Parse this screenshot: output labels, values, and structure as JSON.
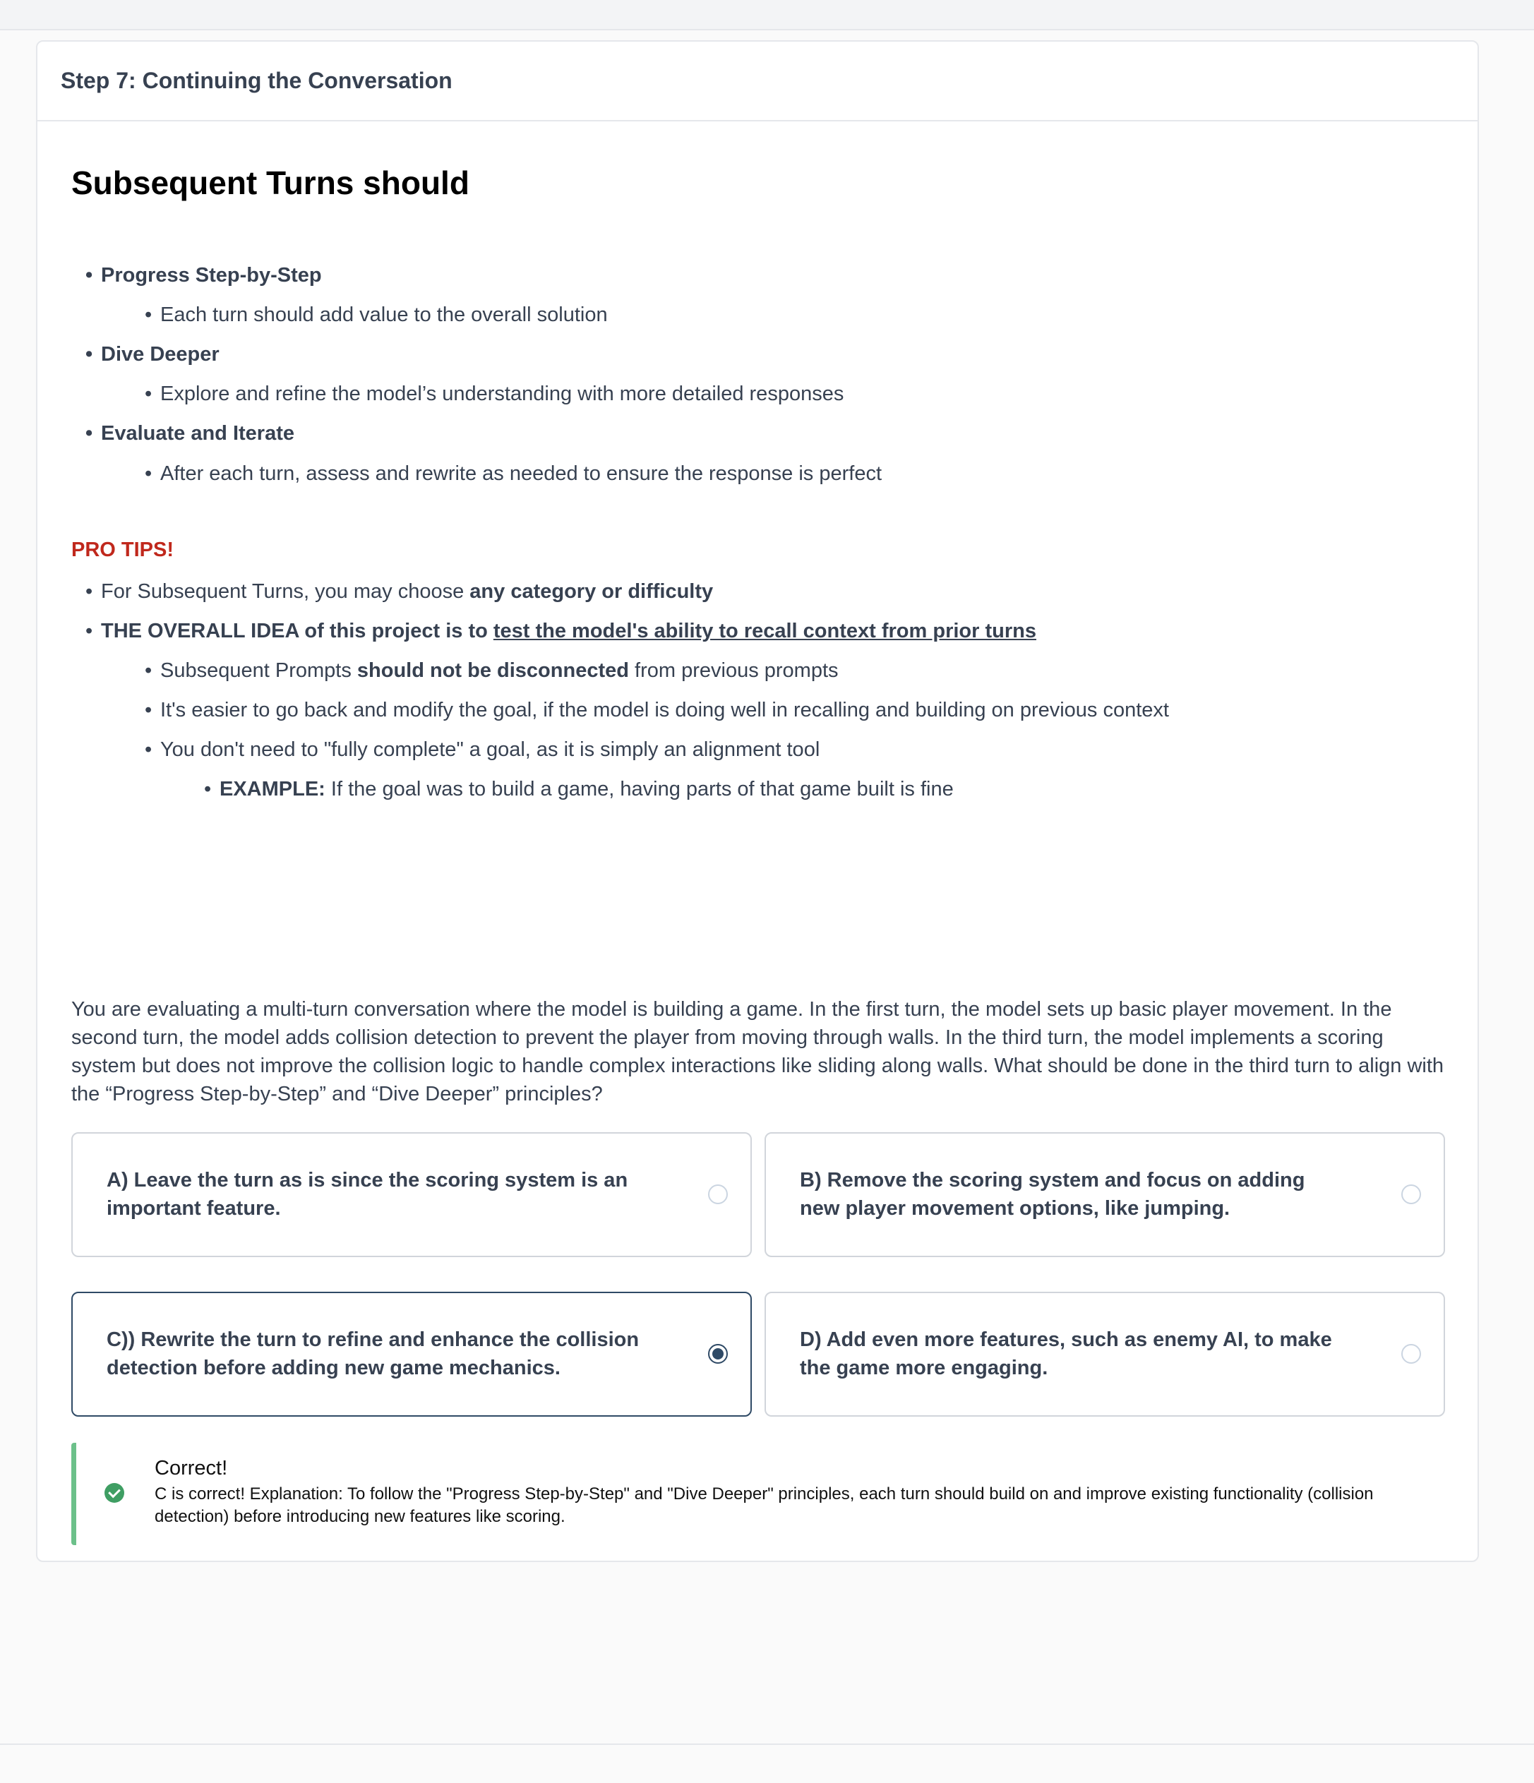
{
  "card": {
    "title": "Step 7: Continuing the Conversation"
  },
  "section": {
    "heading": "Subsequent Turns should",
    "items": [
      {
        "title": "Progress Step-by-Step",
        "detail": "Each turn should add value to the overall solution"
      },
      {
        "title": "Dive Deeper",
        "detail": "Explore and refine the model’s understanding with more detailed responses"
      },
      {
        "title": "Evaluate and Iterate",
        "detail": "After each turn, assess and rewrite as needed to ensure the response is perfect"
      }
    ]
  },
  "pro_tips": {
    "label": "PRO TIPS!",
    "tip1_prefix": "For Subsequent Turns, you may choose ",
    "tip1_bold": "any category or difficulty",
    "tip2_bold": "THE OVERALL IDEA of this project is to ",
    "tip2_underline": "test the model's ability to recall context from prior turns",
    "sub1_prefix": "Subsequent Prompts ",
    "sub1_bold": "should not be disconnected",
    "sub1_suffix": " from previous prompts",
    "sub2": "It's easier to go back and modify the goal, if the model is doing well in recalling and building on previous context",
    "sub3": "You don't need to \"fully complete\" a goal, as it is simply an alignment tool",
    "example_bold": "EXAMPLE:",
    "example_text": " If the goal was to build a game, having parts of that game built is fine"
  },
  "question": {
    "text": "You are evaluating a multi-turn conversation where the model is building a game. In the first turn, the model sets up basic player movement. In the second turn, the model adds collision detection to prevent the player from moving through walls. In the third turn, the model implements a scoring system but does not improve the collision logic to handle complex interactions like sliding along walls. What should be done in the third turn to align with the “Progress Step-by-Step” and “Dive Deeper” principles?",
    "options": [
      {
        "label": "A) Leave the turn as is since the scoring system is an important feature.",
        "selected": false
      },
      {
        "label": "B) Remove the scoring system and focus on adding new player movement options, like jumping.",
        "selected": false
      },
      {
        "label": "C)) Rewrite the turn to refine and enhance the collision detection before adding new game mechanics.",
        "selected": true
      },
      {
        "label": "D) Add even more features, such as enemy AI, to make the game more engaging.",
        "selected": false
      }
    ]
  },
  "feedback": {
    "title": "Correct!",
    "text": "C is correct! Explanation: To follow the \"Progress Step-by-Step\" and \"Dive Deeper\" principles, each turn should build on and improve existing functionality (collision detection) before introducing new features like scoring."
  },
  "colors": {
    "pro_tips": "#c0281c",
    "selected_border": "#2f4a66",
    "success": "#3f9e63",
    "success_bar": "#6cc08a"
  }
}
